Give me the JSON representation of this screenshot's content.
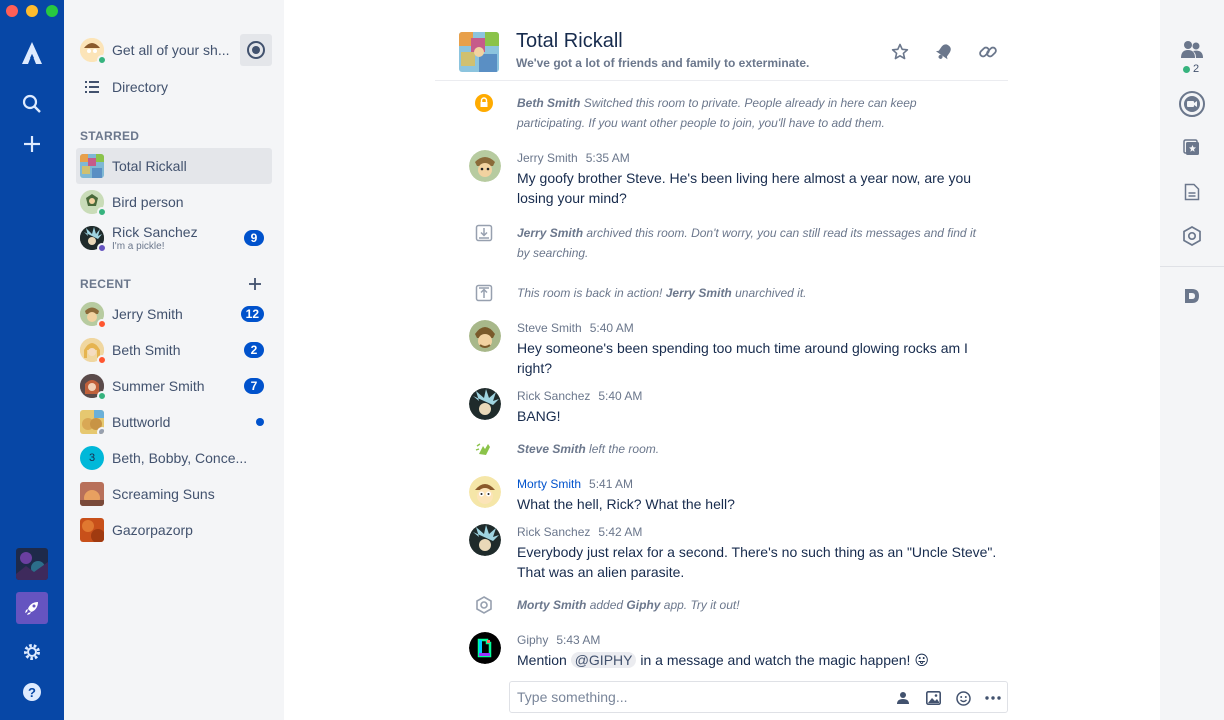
{
  "sidebar": {
    "top": [
      {
        "label": "Get all of your sh..."
      },
      {
        "label": "Directory"
      }
    ],
    "starred_title": "STARRED",
    "starred": [
      {
        "label": "Total Rickall"
      },
      {
        "label": "Bird person"
      },
      {
        "label": "Rick Sanchez",
        "status": "I'm a pickle!",
        "badge": "9"
      }
    ],
    "recent_title": "RECENT",
    "recent": [
      {
        "label": "Jerry Smith",
        "badge": "12"
      },
      {
        "label": "Beth Smith",
        "badge": "2"
      },
      {
        "label": "Summer Smith",
        "badge": "7"
      },
      {
        "label": "Buttworld"
      },
      {
        "label": "Beth, Bobby, Conce...",
        "avatar_text": "3"
      },
      {
        "label": "Screaming Suns"
      },
      {
        "label": "Gazorpazorp"
      }
    ]
  },
  "room": {
    "title": "Total Rickall",
    "topic": "We've got a lot of friends and family to exterminate."
  },
  "messages": [
    {
      "kind": "system",
      "actor": "Beth Smith",
      "text": "Switched this room to private. People already in here can keep participating. If you want other people to join, you'll have to add them."
    },
    {
      "kind": "msg",
      "name": "Jerry Smith",
      "time": "5:35 AM",
      "text": "My goofy brother Steve. He's been living here almost a year now, are you losing your mind?"
    },
    {
      "kind": "system",
      "actor": "Jerry Smith",
      "text": "archived this room. Don't worry, you can still read its messages and find it by searching."
    },
    {
      "kind": "system",
      "pre": "This room is back in action!",
      "actor": "Jerry Smith",
      "text": "unarchived it."
    },
    {
      "kind": "msg",
      "name": "Steve Smith",
      "time": "5:40 AM",
      "text": "Hey someone's been spending too much time around glowing rocks am I right?"
    },
    {
      "kind": "msg",
      "name": "Rick Sanchez",
      "time": "5:40 AM",
      "text": "BANG!"
    },
    {
      "kind": "system",
      "actor": "Steve Smith",
      "text": "left the room."
    },
    {
      "kind": "msg",
      "name": "Morty Smith",
      "time": "5:41 AM",
      "text": "What the hell, Rick? What the hell?"
    },
    {
      "kind": "msg",
      "name": "Rick Sanchez",
      "time": "5:42 AM",
      "text": "Everybody just relax for a second. There's no such thing as an \"Uncle Steve\". That was an alien parasite."
    },
    {
      "kind": "system",
      "actor": "Morty Smith",
      "text": "added",
      "app": "Giphy",
      "text2": "app. Try it out!"
    },
    {
      "kind": "msg",
      "name": "Giphy",
      "time": "5:43 AM",
      "pre": "Mention",
      "mention": "@GIPHY",
      "text": "in a message and watch the magic happen!",
      "emoji": "😛"
    }
  ],
  "composer": {
    "placeholder": "Type something..."
  },
  "rail": {
    "participants_count": "2"
  },
  "colors": {
    "nav": "#0747a6",
    "sidebar": "#f4f5f7",
    "badge": "#0052cc",
    "online": "#36b37e",
    "busy": "#ff5630",
    "lock": "#ffab00"
  }
}
